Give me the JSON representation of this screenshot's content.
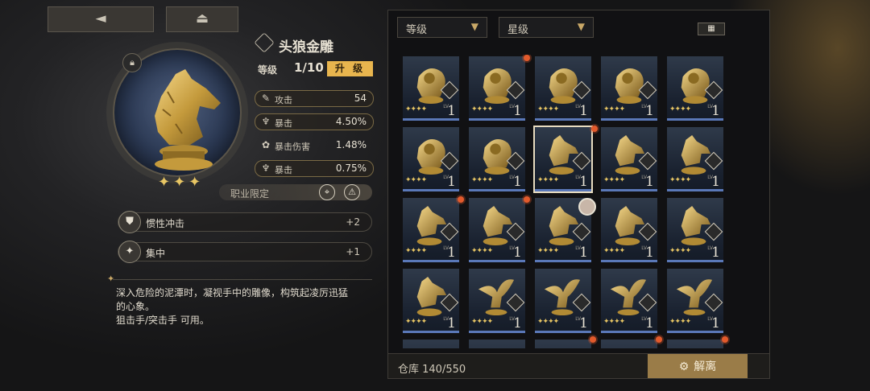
{
  "header": {
    "back_glyph": "◄",
    "eject_glyph": "⏏"
  },
  "item": {
    "name": "头狼金雕",
    "level_label": "等级",
    "level_value": "1/10",
    "upgrade_label": "升 级",
    "rarity_stars": "✦✦✦",
    "stats": [
      {
        "icon": "sword-icon",
        "glyph": "✎",
        "label": "攻击",
        "value": "54"
      },
      {
        "icon": "trophy-icon",
        "glyph": "♆",
        "label": "暴击",
        "value": "4.50%"
      },
      {
        "icon": "crit-damage-icon",
        "glyph": "✿",
        "label": "暴击伤害",
        "value": "1.48%"
      },
      {
        "icon": "trophy-icon",
        "glyph": "♆",
        "label": "暴击",
        "value": "0.75%"
      }
    ],
    "job_label": "职业限定",
    "skills": [
      {
        "name": "惯性冲击",
        "value": "+2"
      },
      {
        "name": "集中",
        "value": "+1"
      }
    ],
    "description": [
      "深入危险的泥潭时，凝视手中的雕像，构筑起凌厉迅猛",
      "的心象。",
      "狙击手/突击手 可用。"
    ]
  },
  "inventory": {
    "filter_level": "等级",
    "filter_star": "星级",
    "grid_glyph": "▦",
    "cell_lv_tag": "LV",
    "cell_lv_value": "1",
    "cell_stars": "✦✦✦✦",
    "storage_label": "仓库 140/550",
    "dismantle_label": "解离"
  },
  "colors": {
    "accent_gold": "#e8b54e",
    "dismantle_bg": "#9a7c48",
    "new_dot": "#e25a2c",
    "cell_border": "#5a78b8"
  }
}
